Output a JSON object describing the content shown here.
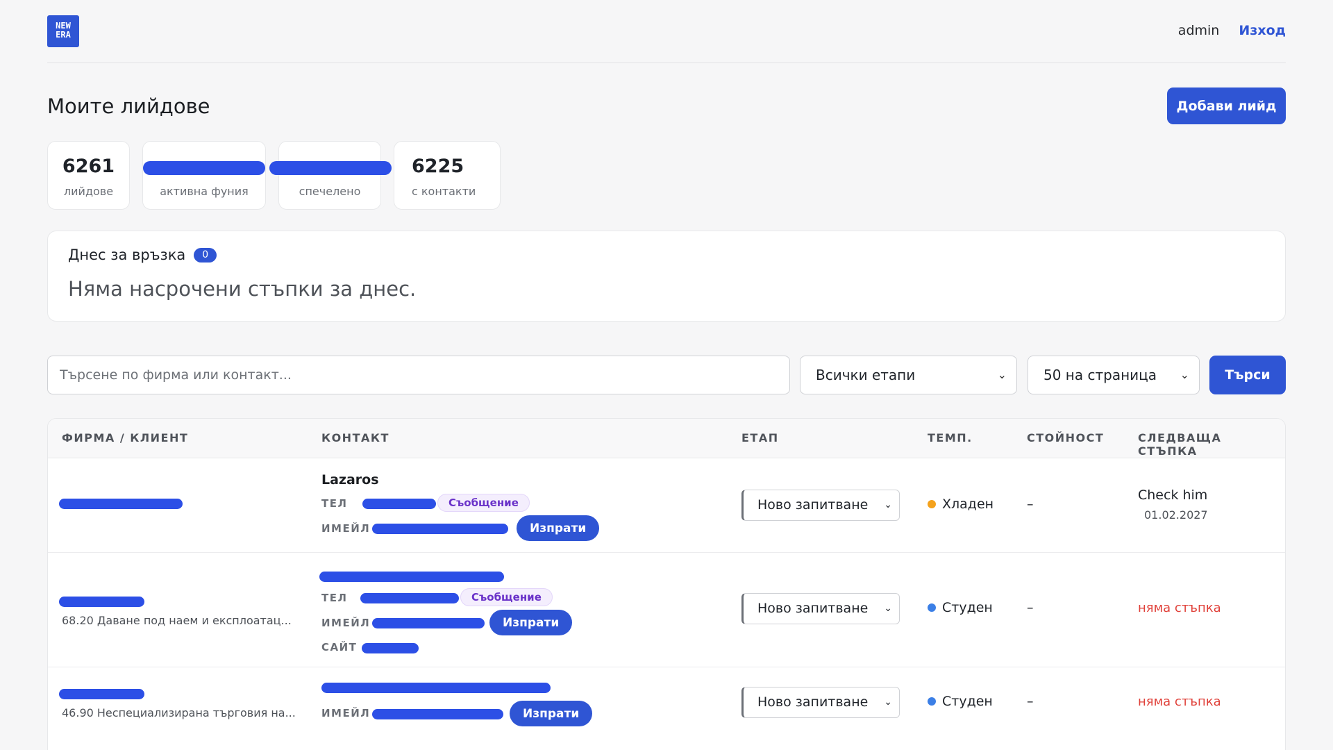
{
  "logo": {
    "line1": "NEW",
    "line2": "ERA"
  },
  "header": {
    "username": "admin",
    "logout_label": "Изход"
  },
  "page": {
    "title": "Моите лийдове",
    "add_button": "Добави лийд"
  },
  "stats": [
    {
      "value": "6261",
      "label": "лийдове"
    },
    {
      "value": "",
      "label": "активна фуния"
    },
    {
      "value": "",
      "label": "спечелено"
    },
    {
      "value": "6225",
      "label": "с контакти"
    }
  ],
  "today": {
    "title": "Днес за връзка",
    "count": "0",
    "empty_text": "Няма насрочени стъпки за днес."
  },
  "filters": {
    "search_placeholder": "Търсене по фирма или контакт...",
    "stage_selected": "Всички етапи",
    "per_page_selected": "50 на страница",
    "search_button": "Търси"
  },
  "table": {
    "headers": [
      "ФИРМА / КЛИЕНТ",
      "КОНТАКТ",
      "ЕТАП",
      "ТЕМП.",
      "СТОЙНОСТ",
      "СЛЕДВАЩА СТЪПКА"
    ],
    "contact_labels": {
      "phone": "ТЕЛ",
      "email": "ИМЕЙЛ",
      "site": "САЙТ"
    },
    "message_pill": "Съобщение",
    "send_button": "Изпрати",
    "rows": [
      {
        "firm_sub": "",
        "contact_name": "Lazaros",
        "stage": "Ново запитване",
        "temp": "Хладен",
        "temp_color": "#f4a21c",
        "value": "–",
        "next_title": "Check him",
        "next_date": "01.02.2027"
      },
      {
        "firm_sub": "68.20 Даване под наем и експлоатац...",
        "stage": "Ново запитване",
        "temp": "Студен",
        "temp_color": "#3b7fe6",
        "value": "–",
        "next_none": "няма стъпка"
      },
      {
        "firm_sub": "46.90 Неспециализирана търговия на...",
        "stage": "Ново запитване",
        "temp": "Студен",
        "temp_color": "#3b7fe6",
        "value": "–",
        "next_none": "няма стъпка"
      }
    ]
  },
  "colors": {
    "accent": "#2f55d4",
    "redaction": "#2c4fe6",
    "danger": "#e0413a",
    "message_pill": "#6a32c9"
  }
}
